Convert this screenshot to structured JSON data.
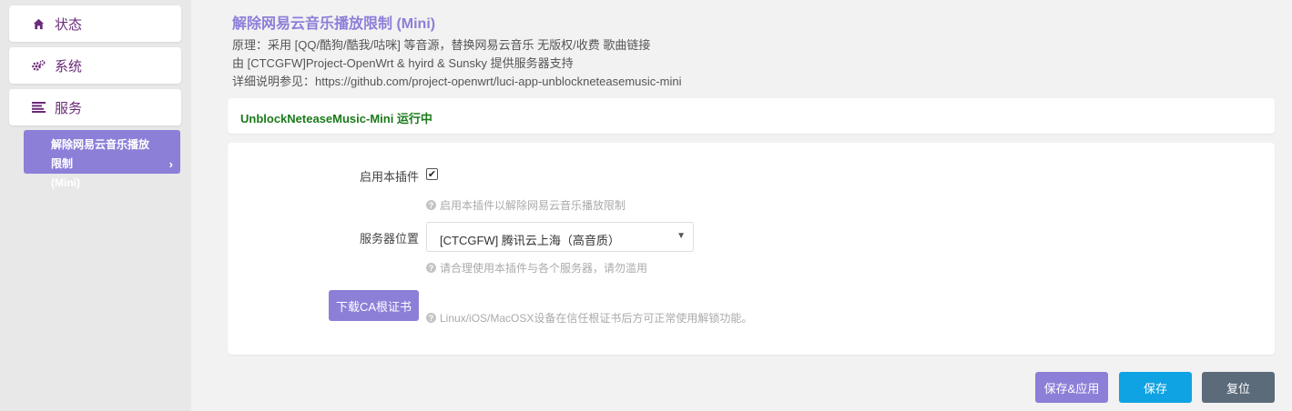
{
  "sidebar": {
    "items": [
      {
        "label": "状态",
        "icon": "home-icon"
      },
      {
        "label": "系统",
        "icon": "gears-icon"
      },
      {
        "label": "服务",
        "icon": "list-icon"
      }
    ],
    "active_sub": {
      "line1": "解除网易云音乐播放限制",
      "line2": "(Mini)",
      "chevron": "›"
    }
  },
  "header": {
    "title": "解除网易云音乐播放限制 (Mini)",
    "desc_lines": [
      "原理：采用 [QQ/酷狗/酷我/咕咪] 等音源，替换网易云音乐 无版权/收费 歌曲链接",
      "由 [CTCGFW]Project-OpenWrt & hyird & Sunsky 提供服务器支持",
      "详细说明参见：https://github.com/project-openwrt/luci-app-unblockneteasemusic-mini"
    ]
  },
  "status": {
    "text": "UnblockNeteaseMusic-Mini 运行中",
    "color": "#1a7a1a"
  },
  "form": {
    "enable": {
      "label": "启用本插件",
      "checked": true,
      "check_mark": "✔",
      "help": "启用本插件以解除网易云音乐播放限制"
    },
    "server": {
      "label": "服务器位置",
      "value": "[CTCGFW] 腾讯云上海（高音质）",
      "caret": "▼",
      "help": "请合理使用本插件与各个服务器，请勿滥用"
    },
    "ca": {
      "button_label": "下载CA根证书",
      "help": "Linux/iOS/MacOSX设备在信任根证书后方可正常使用解锁功能。"
    },
    "help_icon_glyph": "?"
  },
  "actions": {
    "save_apply": "保存&应用",
    "save": "保存",
    "reset": "复位"
  },
  "colors": {
    "accent": "#8c7fd8",
    "save_button": "#0fa3e3",
    "reset_button": "#5c6b7a",
    "sidebar_text": "#6b2a7a"
  }
}
